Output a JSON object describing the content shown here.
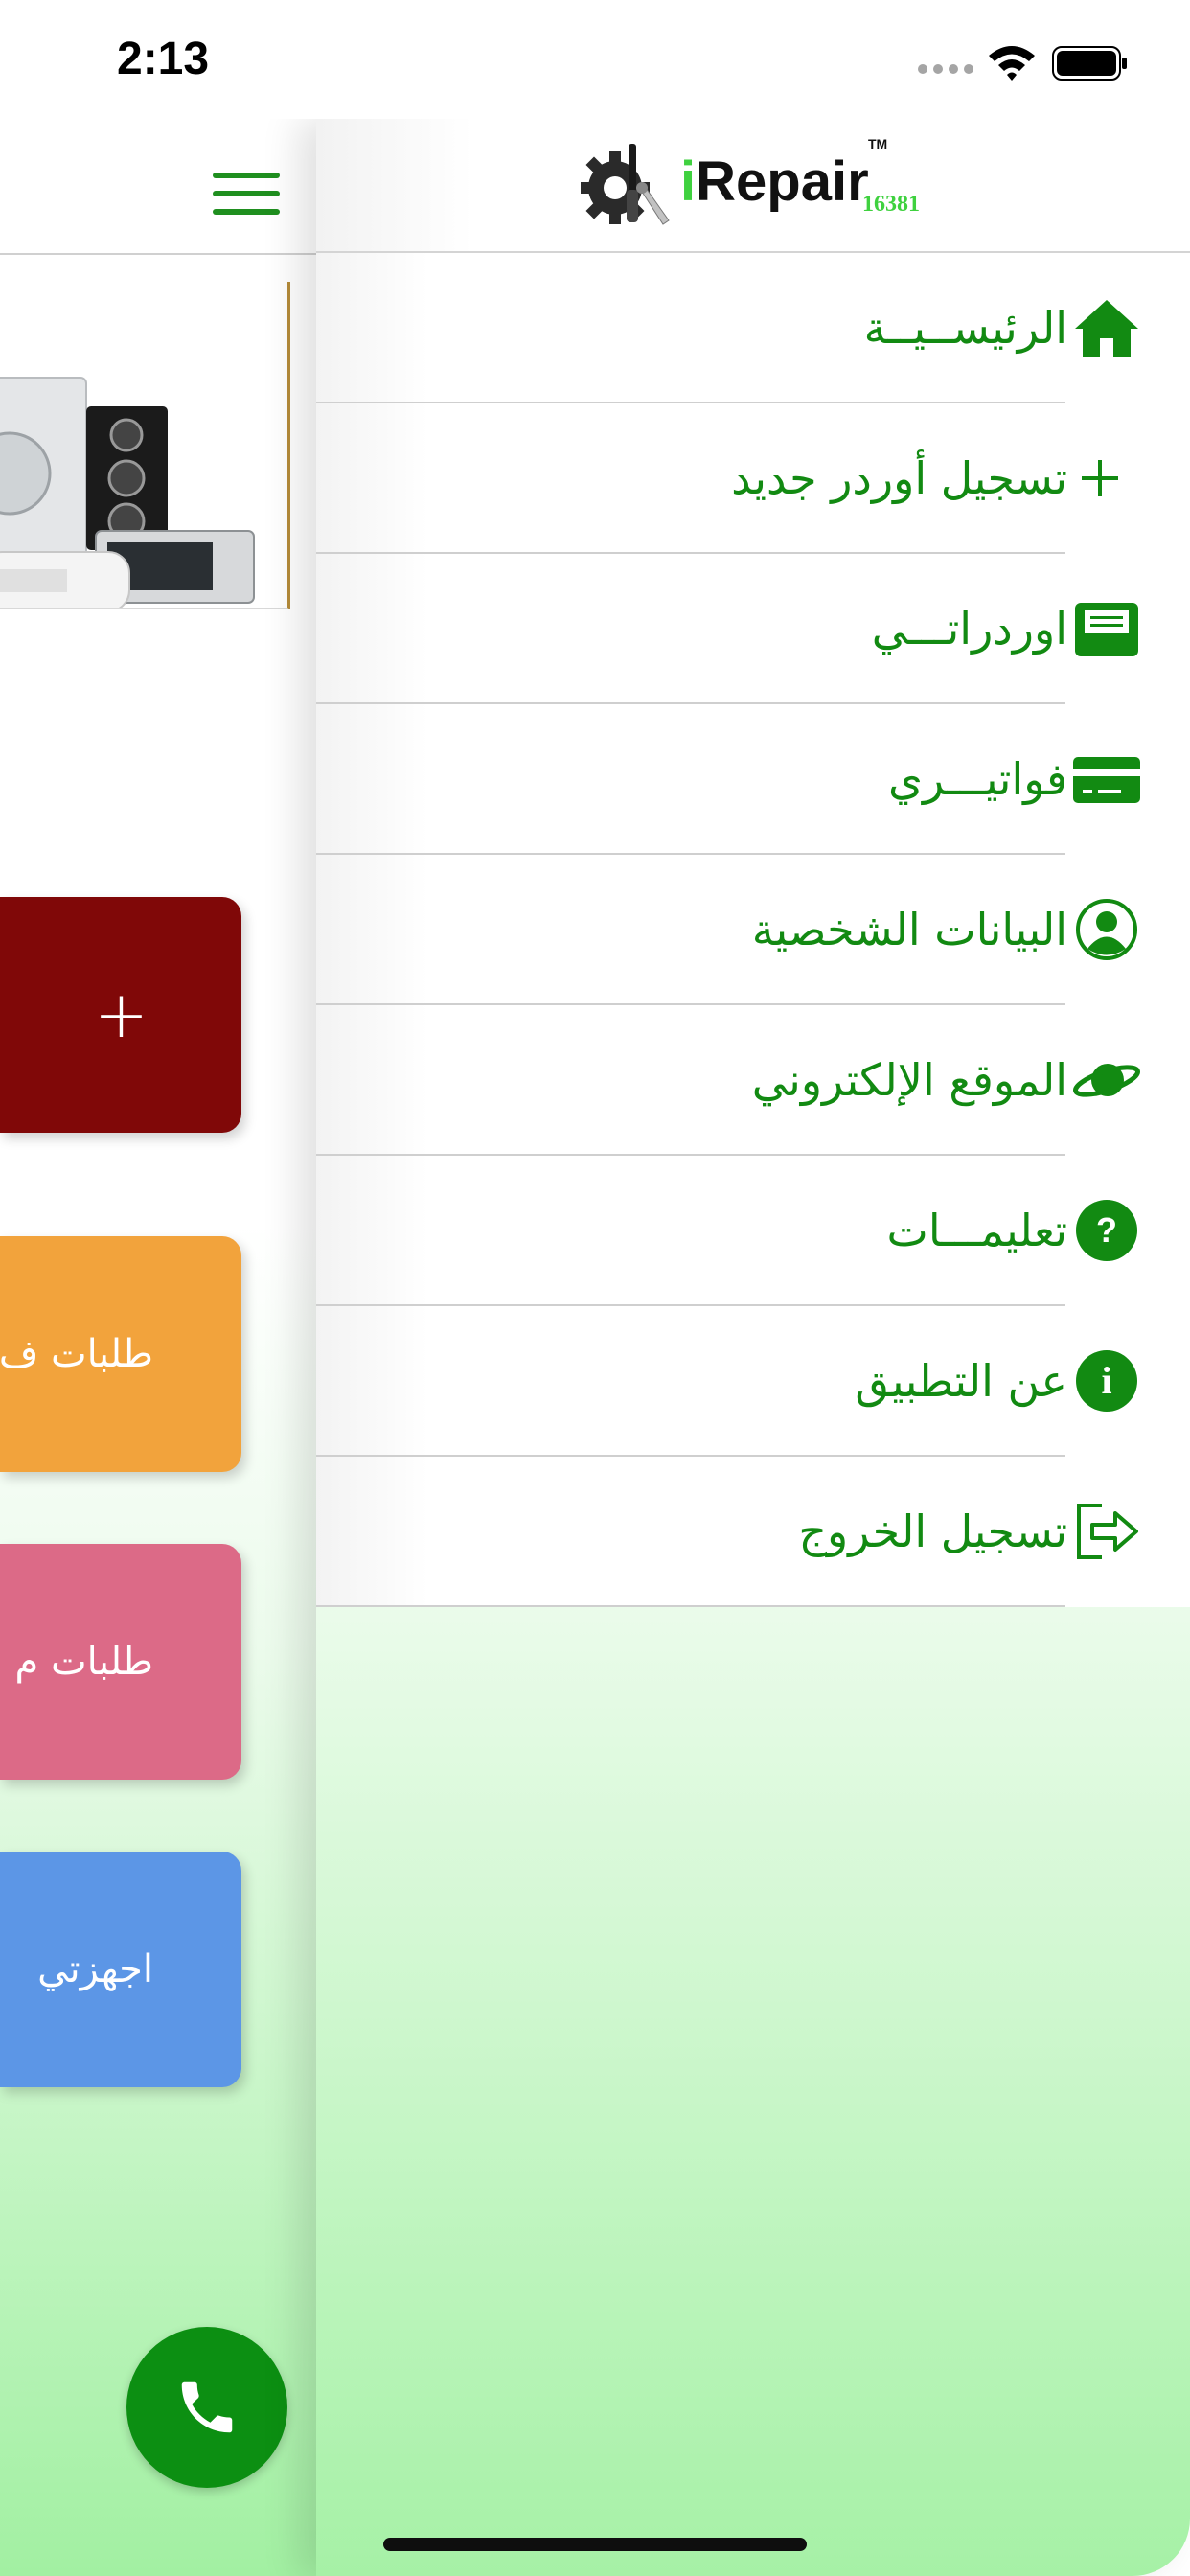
{
  "status_bar": {
    "time": "2:13"
  },
  "app": {
    "logo_text": "Repair",
    "logo_i": "i",
    "logo_tm": "TM",
    "logo_number": "16381"
  },
  "menu": [
    {
      "label": "الرئيســيــة",
      "icon": "home-icon"
    },
    {
      "label": "تسجيل أوردر جديد",
      "icon": "plus-icon"
    },
    {
      "label": "اوردراتـــي",
      "icon": "inbox-icon"
    },
    {
      "label": "فواتيـــري",
      "icon": "credit-card-icon"
    },
    {
      "label": "البيانات الشخصية",
      "icon": "user-circle-icon"
    },
    {
      "label": "الموقع الإلكتروني",
      "icon": "planet-icon"
    },
    {
      "label": "تعليمـــات",
      "icon": "question-circle-icon"
    },
    {
      "label": "عن التطبيق",
      "icon": "info-circle-icon"
    },
    {
      "label": "تسجيل الخروج",
      "icon": "logout-icon"
    }
  ],
  "main": {
    "tiles": [
      {
        "label": "+",
        "color": "#800808"
      },
      {
        "label": "طلبات ف",
        "color": "#f2a33c"
      },
      {
        "label": "طلبات م",
        "color": "#dc6a87"
      },
      {
        "label": "اجهزتي",
        "color": "#5c96e6"
      }
    ],
    "call_button_icon": "phone-icon"
  },
  "colors": {
    "accent_green": "#128a12",
    "call_green": "#0c8f12"
  }
}
